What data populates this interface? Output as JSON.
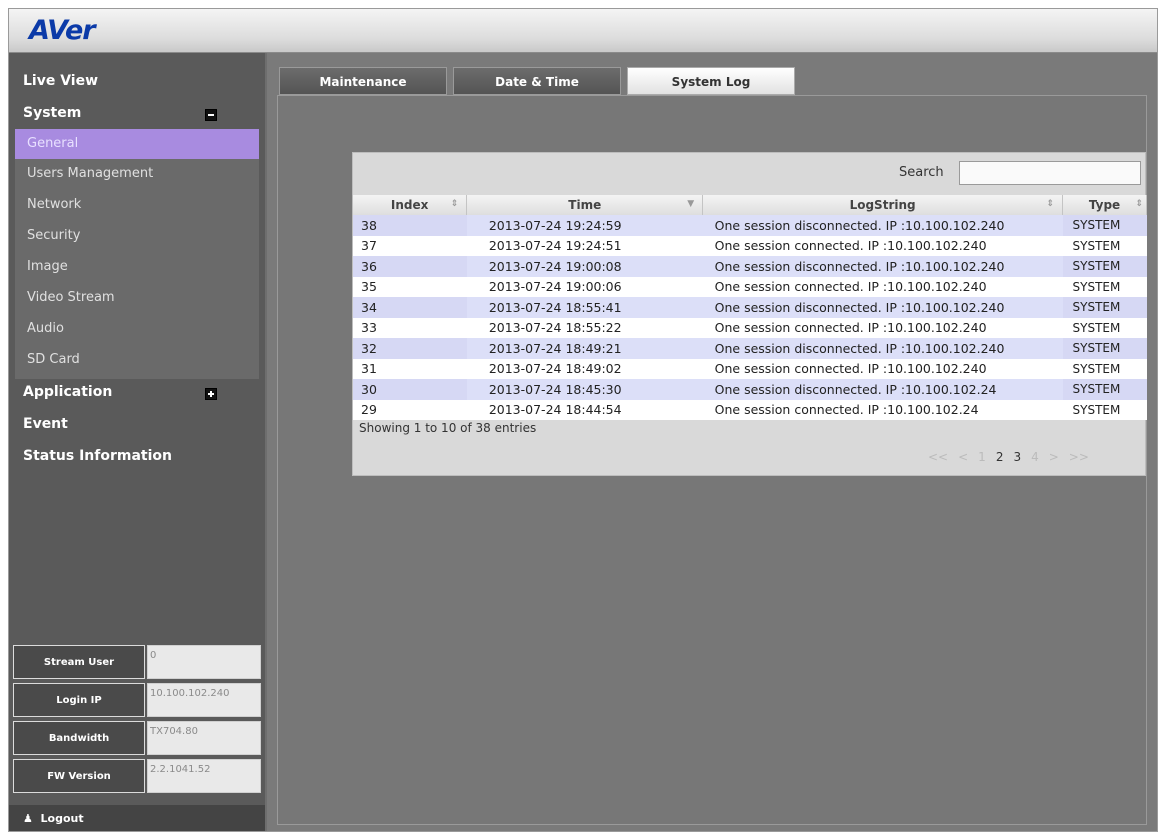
{
  "header": {
    "logo_a": "AV",
    "logo_b": "er"
  },
  "sidebar": {
    "live_view": "Live View",
    "system": "System",
    "system_items": [
      "General",
      "Users Management",
      "Network",
      "Security",
      "Image",
      "Video Stream",
      "Audio",
      "SD Card"
    ],
    "application": "Application",
    "event": "Event",
    "status_information": "Status Information",
    "info": [
      {
        "label": "Stream User",
        "value": "0"
      },
      {
        "label": "Login IP",
        "value": "10.100.102.240"
      },
      {
        "label": "Bandwidth",
        "value": "TX704.80"
      },
      {
        "label": "FW Version",
        "value": "2.2.1041.52"
      }
    ],
    "logout": "Logout"
  },
  "tabs": [
    "Maintenance",
    "Date & Time",
    "System Log"
  ],
  "search": {
    "label": "Search",
    "value": ""
  },
  "table": {
    "headers": [
      "Index",
      "Time",
      "LogString",
      "Type"
    ],
    "rows": [
      [
        "38",
        "2013-07-24 19:24:59",
        "One session disconnected. IP :10.100.102.240",
        "SYSTEM"
      ],
      [
        "37",
        "2013-07-24 19:24:51",
        "One session connected. IP :10.100.102.240",
        "SYSTEM"
      ],
      [
        "36",
        "2013-07-24 19:00:08",
        "One session disconnected. IP :10.100.102.240",
        "SYSTEM"
      ],
      [
        "35",
        "2013-07-24 19:00:06",
        "One session connected. IP :10.100.102.240",
        "SYSTEM"
      ],
      [
        "34",
        "2013-07-24 18:55:41",
        "One session disconnected. IP :10.100.102.240",
        "SYSTEM"
      ],
      [
        "33",
        "2013-07-24 18:55:22",
        "One session connected. IP :10.100.102.240",
        "SYSTEM"
      ],
      [
        "32",
        "2013-07-24 18:49:21",
        "One session disconnected. IP :10.100.102.240",
        "SYSTEM"
      ],
      [
        "31",
        "2013-07-24 18:49:02",
        "One session connected. IP :10.100.102.240",
        "SYSTEM"
      ],
      [
        "30",
        "2013-07-24 18:45:30",
        "One session disconnected. IP :10.100.102.24",
        "SYSTEM"
      ],
      [
        "29",
        "2013-07-24 18:44:54",
        "One session connected. IP :10.100.102.24",
        "SYSTEM"
      ]
    ]
  },
  "showing": "Showing 1 to 10 of 38 entries",
  "pager": [
    "<<",
    "<",
    "1",
    "2",
    "3",
    "4",
    ">",
    ">>"
  ]
}
